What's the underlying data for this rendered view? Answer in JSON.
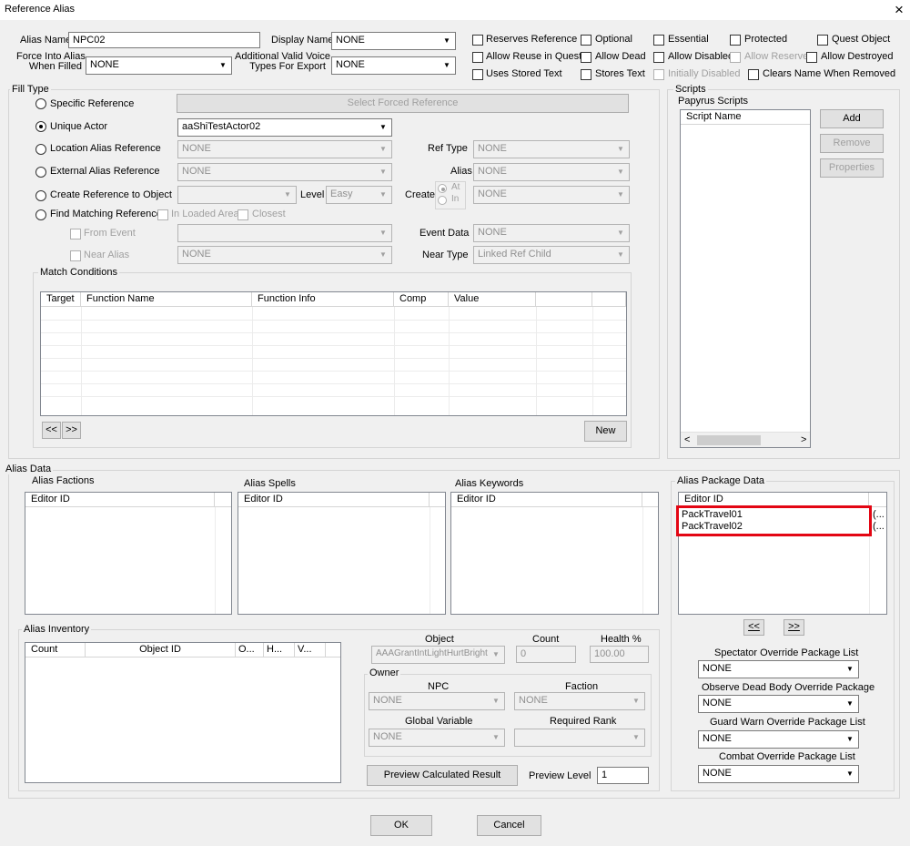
{
  "window": {
    "title": "Reference Alias",
    "close": "×"
  },
  "alias_name": {
    "label": "Alias Name",
    "value": "NPC02"
  },
  "display_name": {
    "label": "Display Name",
    "value": "NONE"
  },
  "force_into": {
    "label1": "Force Into Alias",
    "label2": "When Filled",
    "value": "NONE"
  },
  "voice_types": {
    "label1": "Additional Valid Voice",
    "label2": "Types For Export",
    "value": "NONE"
  },
  "flags": {
    "reserves": "Reserves Reference",
    "optional": "Optional",
    "essential": "Essential",
    "protected": "Protected",
    "quest_object": "Quest Object",
    "allow_reuse": "Allow Reuse in Quest",
    "allow_dead": "Allow Dead",
    "allow_disabled": "Allow Disabled",
    "allow_reserved": "Allow Reserved",
    "allow_destroyed": "Allow Destroyed",
    "uses_stored": "Uses Stored Text",
    "stores_text": "Stores Text",
    "initially_disabled": "Initially Disabled",
    "clears_name": "Clears Name When Removed"
  },
  "fill": {
    "group": "Fill Type",
    "specific": "Specific Reference",
    "select_forced": "Select Forced Reference",
    "unique": "Unique Actor",
    "unique_value": "aaShiTestActor02",
    "location": "Location Alias Reference",
    "location_value": "NONE",
    "ref_type_label": "Ref Type",
    "ref_type_value": "NONE",
    "external": "External Alias Reference",
    "external_value": "NONE",
    "alias_label": "Alias",
    "alias_value": "NONE",
    "create": "Create Reference to Object",
    "level_label": "Level",
    "level_value": "Easy",
    "create_label": "Create",
    "at": "At",
    "in": "In",
    "create_value": "NONE",
    "find": "Find Matching Reference",
    "in_loaded": "In Loaded Area",
    "closest": "Closest",
    "from_event": "From Event",
    "event_data_label": "Event Data",
    "event_data_value": "NONE",
    "near_alias": "Near Alias",
    "near_alias_value": "NONE",
    "near_type_label": "Near Type",
    "near_type_value": "Linked Ref Child"
  },
  "match": {
    "group": "Match Conditions",
    "cols": [
      "Target",
      "Function Name",
      "Function Info",
      "Comp",
      "Value"
    ],
    "prev": "<<",
    "next": ">>",
    "new": "New"
  },
  "scripts": {
    "group": "Scripts",
    "subtitle": "Papyrus Scripts",
    "col": "Script Name",
    "add": "Add",
    "remove": "Remove",
    "properties": "Properties",
    "scroll_left": "<",
    "scroll_right": ">"
  },
  "alias_data": {
    "group": "Alias Data",
    "factions": "Alias Factions",
    "spells": "Alias Spells",
    "keywords": "Alias Keywords",
    "editor_id": "Editor ID"
  },
  "package": {
    "group": "Alias Package Data",
    "col": "Editor ID",
    "rows": [
      "PackTravel01",
      "PackTravel02"
    ],
    "extra": "(...",
    "prev": "<<",
    "next": ">>",
    "spectator": "Spectator Override Package List",
    "spectator_value": "NONE",
    "observe": "Observe Dead Body Override Package",
    "observe_value": "NONE",
    "guard": "Guard Warn Override Package List",
    "guard_value": "NONE",
    "combat": "Combat Override Package List",
    "combat_value": "NONE"
  },
  "inventory": {
    "group": "Alias Inventory",
    "cols": [
      "Count",
      "Object ID",
      "O...",
      "H...",
      "V..."
    ],
    "object_label": "Object",
    "object_value": "AAAGrantIntLightHurtBright",
    "count_label": "Count",
    "count_value": "0",
    "health_label": "Health %",
    "health_value": "100.00",
    "owner": "Owner",
    "npc_label": "NPC",
    "npc_value": "NONE",
    "faction_label": "Faction",
    "faction_value": "NONE",
    "global_label": "Global Variable",
    "global_value": "NONE",
    "rank_label": "Required Rank",
    "rank_value": "",
    "preview_btn": "Preview Calculated Result",
    "preview_level_label": "Preview Level",
    "preview_level_value": "1"
  },
  "footer": {
    "ok": "OK",
    "cancel": "Cancel"
  }
}
